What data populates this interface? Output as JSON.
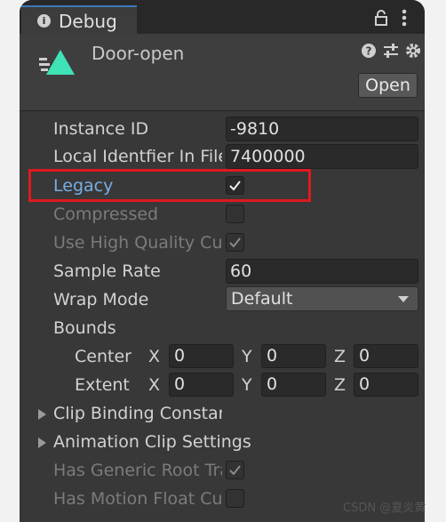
{
  "tab": {
    "label": "Debug",
    "info_icon": "i"
  },
  "header": {
    "asset_name": "Door-open",
    "open_label": "Open"
  },
  "fields": {
    "instance_id": {
      "label": "Instance ID",
      "value": "-9810"
    },
    "local_identifier": {
      "label": "Local Identfier In File",
      "value": "7400000"
    },
    "legacy": {
      "label": "Legacy",
      "checked": true
    },
    "compressed": {
      "label": "Compressed",
      "checked": false
    },
    "use_high_quality_curve": {
      "label": "Use High Quality Cur",
      "checked": true
    },
    "sample_rate": {
      "label": "Sample Rate",
      "value": "60"
    },
    "wrap_mode": {
      "label": "Wrap Mode",
      "value": "Default"
    },
    "bounds": {
      "label": "Bounds",
      "center": {
        "label": "Center",
        "x_label": "X",
        "x": "0",
        "y_label": "Y",
        "y": "0",
        "z_label": "Z",
        "z": "0"
      },
      "extent": {
        "label": "Extent",
        "x_label": "X",
        "x": "0",
        "y_label": "Y",
        "y": "0",
        "z_label": "Z",
        "z": "0"
      }
    },
    "clip_binding_constant": {
      "label": "Clip Binding Constant"
    },
    "animation_clip_settings": {
      "label": "Animation Clip Settings"
    },
    "has_generic_root_transform": {
      "label": "Has Generic Root Tra",
      "checked": true
    },
    "has_motion_float_curves": {
      "label": "Has Motion Float Cur",
      "checked": false
    }
  },
  "watermark": "CSDN @夏炎黄",
  "colors": {
    "accent_tab": "#3a79bb",
    "highlight_box": "#e0191f",
    "asset_icon": "#3fe3b5"
  }
}
